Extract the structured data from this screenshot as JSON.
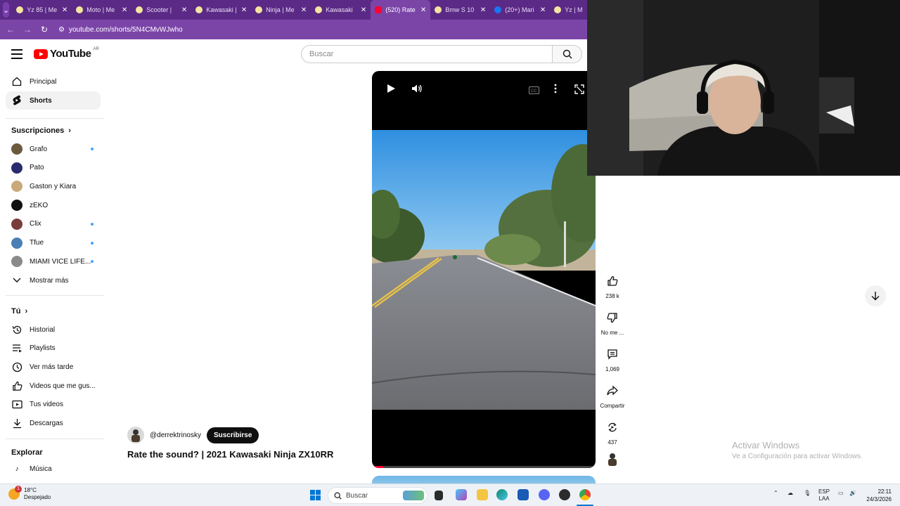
{
  "browser": {
    "tabs": [
      {
        "title": "Yz 85 | Me",
        "icon": "globe-icon"
      },
      {
        "title": "Moto | Me",
        "icon": "globe-icon"
      },
      {
        "title": "Scooter | ",
        "icon": "globe-icon"
      },
      {
        "title": "Kawasaki | ",
        "icon": "globe-icon"
      },
      {
        "title": "Ninja | Me",
        "icon": "globe-icon"
      },
      {
        "title": "Kawasaki ",
        "icon": "globe-icon"
      },
      {
        "title": "(520) Rate",
        "icon": "youtube-icon",
        "active": true
      },
      {
        "title": "Bmw S 10",
        "icon": "globe-icon"
      },
      {
        "title": "(20+) Mari",
        "icon": "facebook-icon"
      },
      {
        "title": "Yz | M",
        "icon": "globe-icon"
      }
    ],
    "url": "youtube.com/shorts/5N4CMvWJwho"
  },
  "header": {
    "logo_text": "YouTube",
    "country": "AR",
    "search_placeholder": "Buscar"
  },
  "sidebar": {
    "main": [
      {
        "label": "Principal",
        "icon": "home-icon"
      },
      {
        "label": "Shorts",
        "icon": "shorts-icon",
        "active": true
      }
    ],
    "subscriptions_title": "Suscripciones",
    "subscriptions": [
      {
        "label": "Grafo",
        "new": true,
        "color": "#6b5a3e"
      },
      {
        "label": "Pato",
        "new": false,
        "color": "#2a2a6e"
      },
      {
        "label": "Gaston y Kiara",
        "new": false,
        "color": "#c9a97a"
      },
      {
        "label": "zEKO",
        "new": false,
        "color": "#111111"
      },
      {
        "label": "Clix",
        "new": true,
        "color": "#7a3b3b"
      },
      {
        "label": "Tfue",
        "new": true,
        "color": "#4a7fb5"
      },
      {
        "label": "MIAMI VICE LIFE...",
        "new": true,
        "color": "#8a8a8a"
      }
    ],
    "show_more": "Mostrar más",
    "you_title": "Tú",
    "you": [
      {
        "label": "Historial",
        "icon": "history-icon"
      },
      {
        "label": "Playlists",
        "icon": "playlists-icon"
      },
      {
        "label": "Ver más tarde",
        "icon": "clock-icon"
      },
      {
        "label": "Videos que me gus...",
        "icon": "like-icon"
      },
      {
        "label": "Tus videos",
        "icon": "video-icon"
      },
      {
        "label": "Descargas",
        "icon": "download-icon"
      }
    ],
    "explore_title": "Explorar",
    "explore": [
      {
        "label": "Música",
        "icon": "music-icon"
      }
    ]
  },
  "short": {
    "channel": "@derrektrinosky",
    "subscribe": "Suscribirse",
    "title": "Rate the sound? | 2021 Kawasaki Ninja ZX10RR",
    "progress": 0.05,
    "actions": [
      {
        "label": "238 k",
        "icon": "like-icon"
      },
      {
        "label": "No me ...",
        "icon": "dislike-icon"
      },
      {
        "label": "1,069",
        "icon": "comment-icon"
      },
      {
        "label": "Compartir",
        "icon": "share-icon"
      },
      {
        "label": "437",
        "icon": "remix-icon"
      }
    ]
  },
  "watermark": {
    "line1": "Activar Windows",
    "line2": "Ve a Configuración para activar Windows."
  },
  "taskbar": {
    "temp": "18°C",
    "weather": "Despejado",
    "notif": "1",
    "search": "Buscar",
    "lang1": "ESP",
    "lang2": "LAA",
    "time": "22:11",
    "date": "24/3/2026"
  }
}
